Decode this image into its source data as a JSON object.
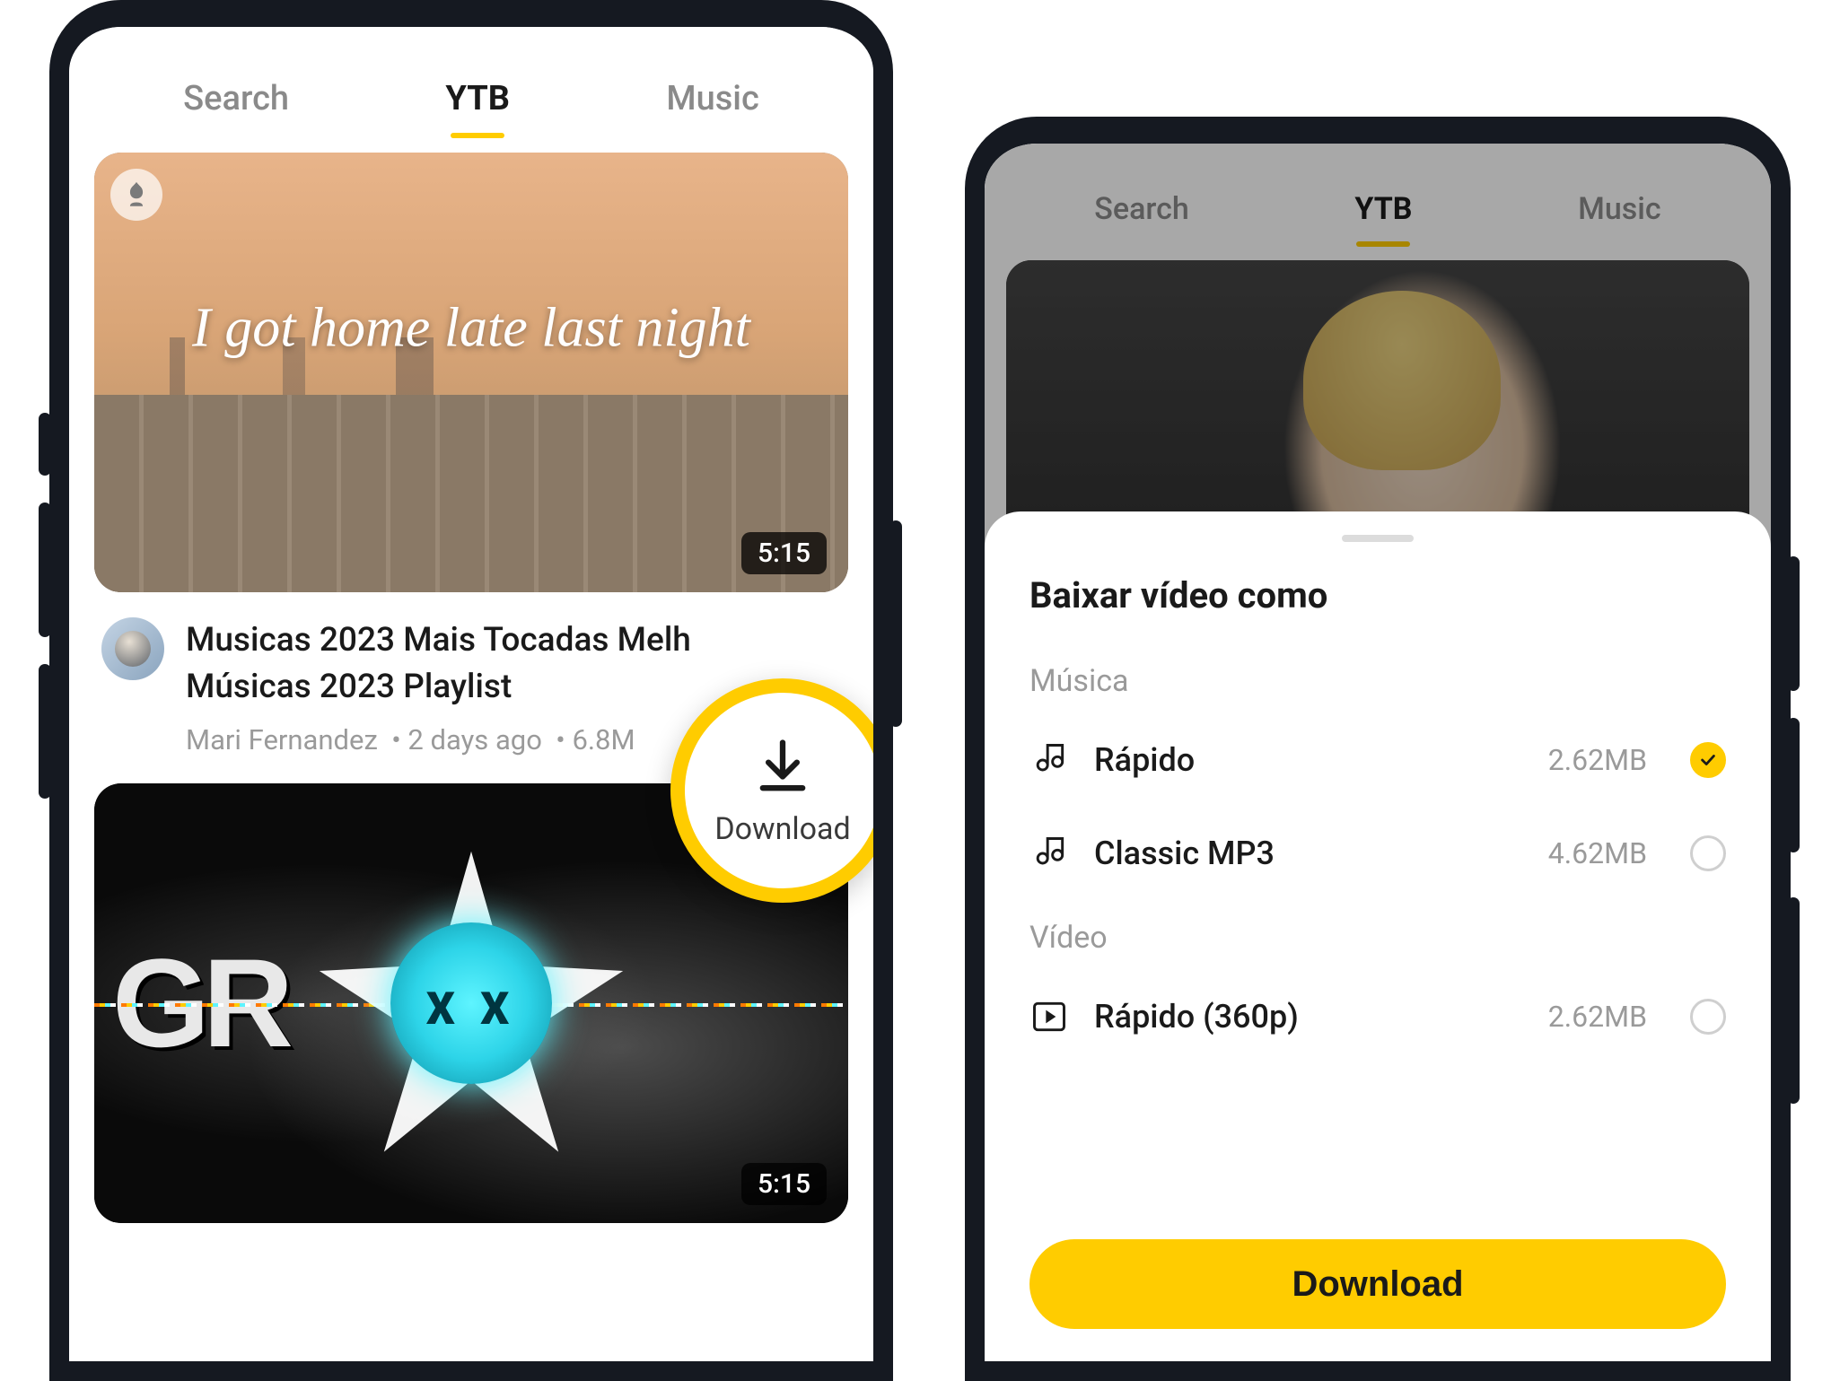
{
  "tabs": {
    "search": "Search",
    "ytb": "YTB",
    "music": "Music"
  },
  "video1": {
    "overlay_text": "I got home late last night",
    "duration": "5:15",
    "title_line1": "Musicas 2023 Mais Tocadas Melh",
    "title_line2": "Músicas 2023 Playlist",
    "author": "Mari Fernandez",
    "posted": "2 days ago",
    "views": "6.8M"
  },
  "download_badge": "Download",
  "video2": {
    "duration": "5:15"
  },
  "sheet": {
    "title": "Baixar vídeo como",
    "section_music": "Música",
    "section_video": "Vídeo",
    "options": {
      "rapido": {
        "label": "Rápido",
        "size": "2.62MB"
      },
      "classic": {
        "label": "Classic MP3",
        "size": "4.62MB"
      },
      "rapido360": {
        "label": "Rápido (360p)",
        "size": "2.62MB"
      }
    },
    "button": "Download"
  },
  "colors": {
    "accent": "#ffcc00"
  }
}
